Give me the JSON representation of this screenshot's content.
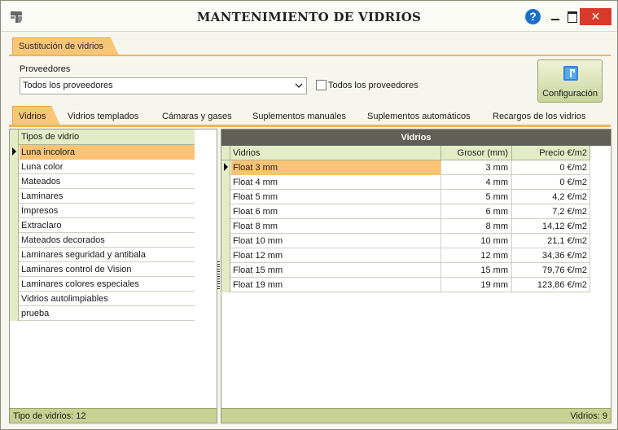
{
  "window": {
    "title": "MANTENIMIENTO DE VIDRIOS",
    "help_label": "?",
    "close_label": "✕"
  },
  "main_tab": {
    "label": "Sustitución de vidrios"
  },
  "proveedores": {
    "label": "Proveedores",
    "selected": "Todos los proveedores",
    "checkbox_label": "Todos los proveedores",
    "checkbox_checked": false
  },
  "config_button": {
    "label": "Configuración"
  },
  "subtabs": [
    {
      "label": "Vidrios",
      "active": true
    },
    {
      "label": "Vidrios templados",
      "active": false
    },
    {
      "label": "Cámaras y gases",
      "active": false
    },
    {
      "label": "Suplementos manuales",
      "active": false
    },
    {
      "label": "Suplementos automáticos",
      "active": false
    },
    {
      "label": "Recargos de los vidrios",
      "active": false
    }
  ],
  "tipos": {
    "header": "Tipos de vidrio",
    "items": [
      "Luna incolora",
      "Luna color",
      "Mateados",
      "Laminares",
      "Impresos",
      "Extraclaro",
      "Mateados decorados",
      "Laminares seguridad y antibala",
      "Laminares control de Vision",
      "Laminares colores especiales",
      "Vidrios autolimpiables",
      "prueba"
    ],
    "selected_index": 0,
    "footer": "Tipo de vidrios: 12"
  },
  "vidrios": {
    "title": "Vidrios",
    "columns": [
      "Vidrios",
      "Grosor (mm)",
      "Precio €/m2"
    ],
    "rows": [
      [
        "Float 3 mm",
        "3 mm",
        "0 €/m2"
      ],
      [
        "Float 4 mm",
        "4 mm",
        "0 €/m2"
      ],
      [
        "Float 5 mm",
        "5 mm",
        "4,2 €/m2"
      ],
      [
        "Float 6 mm",
        "6 mm",
        "7,2 €/m2"
      ],
      [
        "Float 8 mm",
        "8 mm",
        "14,12 €/m2"
      ],
      [
        "Float 10 mm",
        "10 mm",
        "21,1 €/m2"
      ],
      [
        "Float 12 mm",
        "12 mm",
        "34,36 €/m2"
      ],
      [
        "Float 15 mm",
        "15 mm",
        "79,76 €/m2"
      ],
      [
        "Float 19 mm",
        "19 mm",
        "123,86 €/m2"
      ]
    ],
    "selected_index": 0,
    "footer": "Vidrios: 9"
  }
}
